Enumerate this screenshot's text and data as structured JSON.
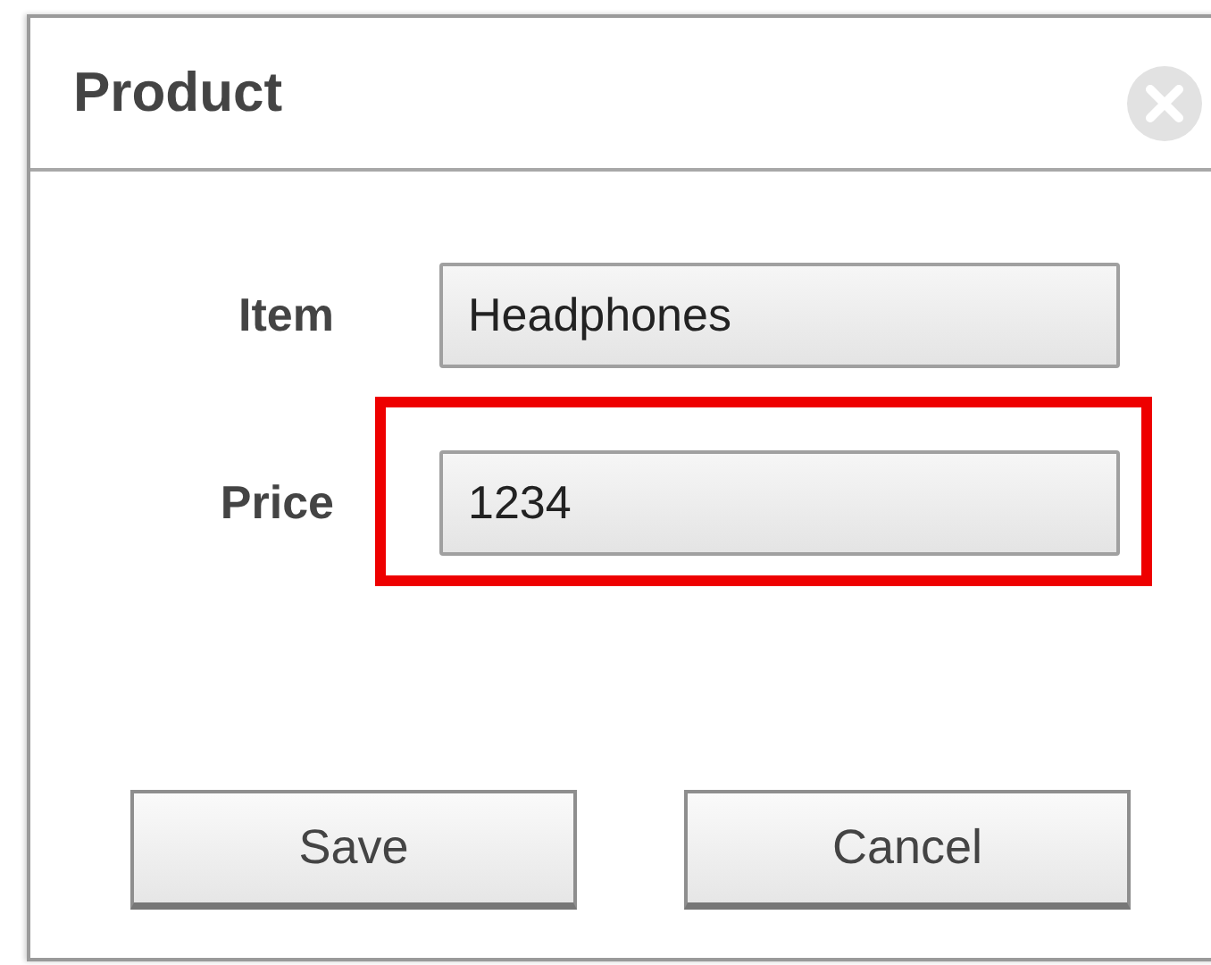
{
  "dialog": {
    "title": "Product"
  },
  "fields": [
    {
      "label": "Item",
      "value": "Headphones",
      "highlighted": false
    },
    {
      "label": "Price",
      "value": "1234",
      "highlighted": true
    }
  ],
  "buttons": [
    "Save",
    "Cancel"
  ]
}
